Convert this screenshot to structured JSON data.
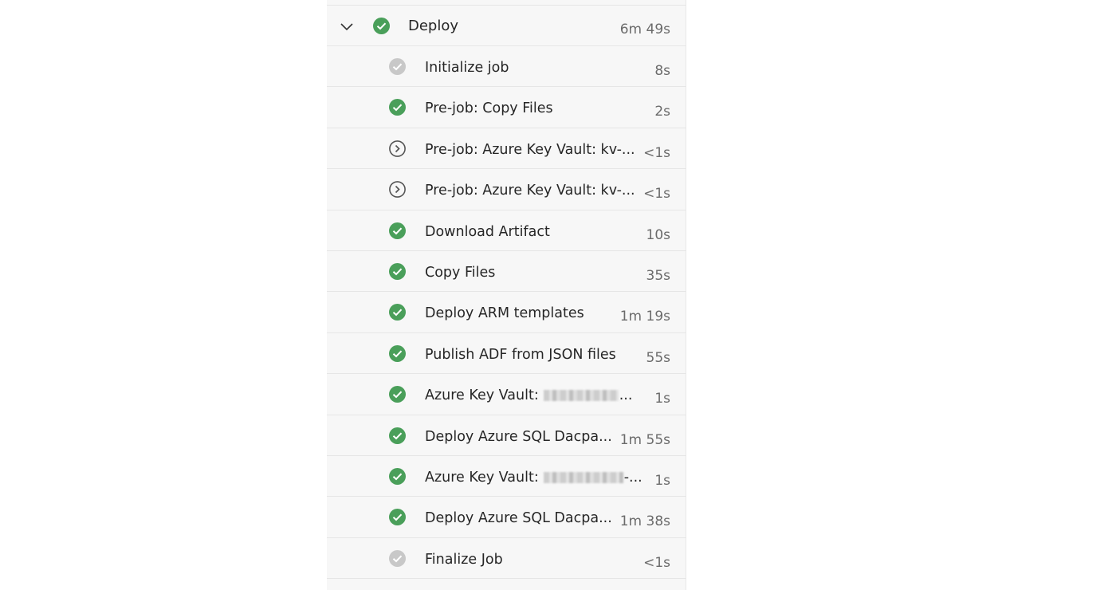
{
  "job": {
    "title": "Deploy",
    "duration": "6m 49s",
    "status": "succeeded"
  },
  "colors": {
    "success": "#4a9f5a",
    "skipped": "#c8c8c8",
    "pending_outline": "#555555",
    "text": "#262626",
    "duration_text": "#6b6b6b"
  },
  "steps": [
    {
      "label": "Initialize job",
      "duration": "8s",
      "status": "skipped",
      "icon": "check-circle-gray-icon"
    },
    {
      "label": "Pre-job: Copy Files",
      "duration": "2s",
      "status": "succeeded",
      "icon": "check-circle-green-icon"
    },
    {
      "label": "Pre-job: Azure Key Vault: kv-...",
      "duration": "<1s",
      "status": "pending",
      "icon": "chevron-circle-icon"
    },
    {
      "label": "Pre-job: Azure Key Vault: kv-...",
      "duration": "<1s",
      "status": "pending",
      "icon": "chevron-circle-icon"
    },
    {
      "label": "Download Artifact",
      "duration": "10s",
      "status": "succeeded",
      "icon": "check-circle-green-icon"
    },
    {
      "label": "Copy Files",
      "duration": "35s",
      "status": "succeeded",
      "icon": "check-circle-green-icon"
    },
    {
      "label": "Deploy ARM templates",
      "duration": "1m 19s",
      "status": "succeeded",
      "icon": "check-circle-green-icon"
    },
    {
      "label": "Publish ADF from JSON files",
      "duration": "55s",
      "status": "succeeded",
      "icon": "check-circle-green-icon"
    },
    {
      "label": "Azure Key Vault:",
      "label_suffix": "...",
      "redacted": true,
      "duration": "1s",
      "status": "succeeded",
      "icon": "check-circle-green-icon"
    },
    {
      "label": "Deploy Azure SQL Dacpa...",
      "duration": "1m 55s",
      "status": "succeeded",
      "icon": "check-circle-green-icon"
    },
    {
      "label": "Azure Key Vault:",
      "label_suffix": "-...",
      "redacted": true,
      "duration": "1s",
      "status": "succeeded",
      "icon": "check-circle-green-icon"
    },
    {
      "label": "Deploy Azure SQL Dacpa...",
      "duration": "1m 38s",
      "status": "succeeded",
      "icon": "check-circle-green-icon"
    },
    {
      "label": "Finalize Job",
      "duration": "<1s",
      "status": "skipped",
      "icon": "check-circle-gray-icon"
    }
  ]
}
